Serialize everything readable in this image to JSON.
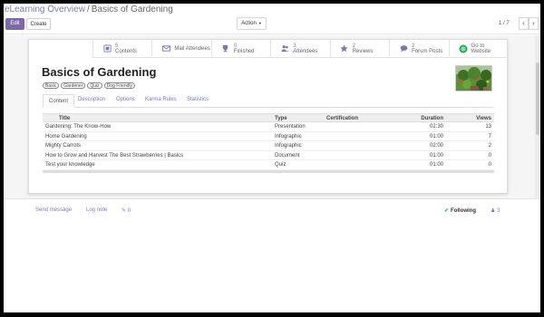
{
  "breadcrumb": {
    "parent": "eLearning Overview",
    "separator": "/",
    "current": "Basics of Gardening"
  },
  "toolbar": {
    "edit_label": "Edit",
    "create_label": "Create",
    "action_label": "Action"
  },
  "pager": {
    "value": "1 / 7",
    "prev": "‹",
    "next": "›"
  },
  "smart_buttons": [
    {
      "icon": "contents-icon",
      "count": "5",
      "label": "Contents"
    },
    {
      "icon": "envelope-icon",
      "count": "",
      "label": "Mail Attendees"
    },
    {
      "icon": "trophy-icon",
      "count": "0",
      "label": "Finished"
    },
    {
      "icon": "users-icon",
      "count": "3",
      "label": "Attendees"
    },
    {
      "icon": "star-icon",
      "count": "2",
      "label": "Reviews"
    },
    {
      "icon": "chat-icon",
      "count": "2",
      "label": "Forum Posts"
    },
    {
      "icon": "globe-icon",
      "count": "Go to",
      "label": "Website"
    }
  ],
  "course": {
    "title": "Basics of Gardening",
    "tags": [
      "Basic",
      "Gardener",
      "Quiz",
      "Dog Friendly"
    ]
  },
  "tabs": [
    "Content",
    "Description",
    "Options",
    "Karma Rules",
    "Statistics"
  ],
  "grid": {
    "columns": {
      "title": "Title",
      "type": "Type",
      "certification": "Certification",
      "duration": "Duration",
      "views": "Views"
    },
    "rows": [
      {
        "title": "Gardening: The Know-How",
        "type": "Presentation",
        "certification": "",
        "duration": "02:30",
        "views": "13"
      },
      {
        "title": "Home Gardening",
        "type": "Infographic",
        "certification": "",
        "duration": "01:00",
        "views": "7"
      },
      {
        "title": "Mighty Carrots",
        "type": "Infographic",
        "certification": "",
        "duration": "02:00",
        "views": "2"
      },
      {
        "title": "How to Grow and Harvest The Best Strawberries | Basics",
        "type": "Document",
        "certification": "",
        "duration": "01:00",
        "views": "0"
      },
      {
        "title": "Test your knowledge",
        "type": "Quiz",
        "certification": "",
        "duration": "01:00",
        "views": "0"
      }
    ]
  },
  "chatter": {
    "send_message": "Send message",
    "log_note": "Log note",
    "attachments": "0",
    "following": "Following",
    "followers": "3"
  },
  "colors": {
    "primary": "#7c6aa8",
    "link": "#7c7bad",
    "following": "#21b799"
  }
}
